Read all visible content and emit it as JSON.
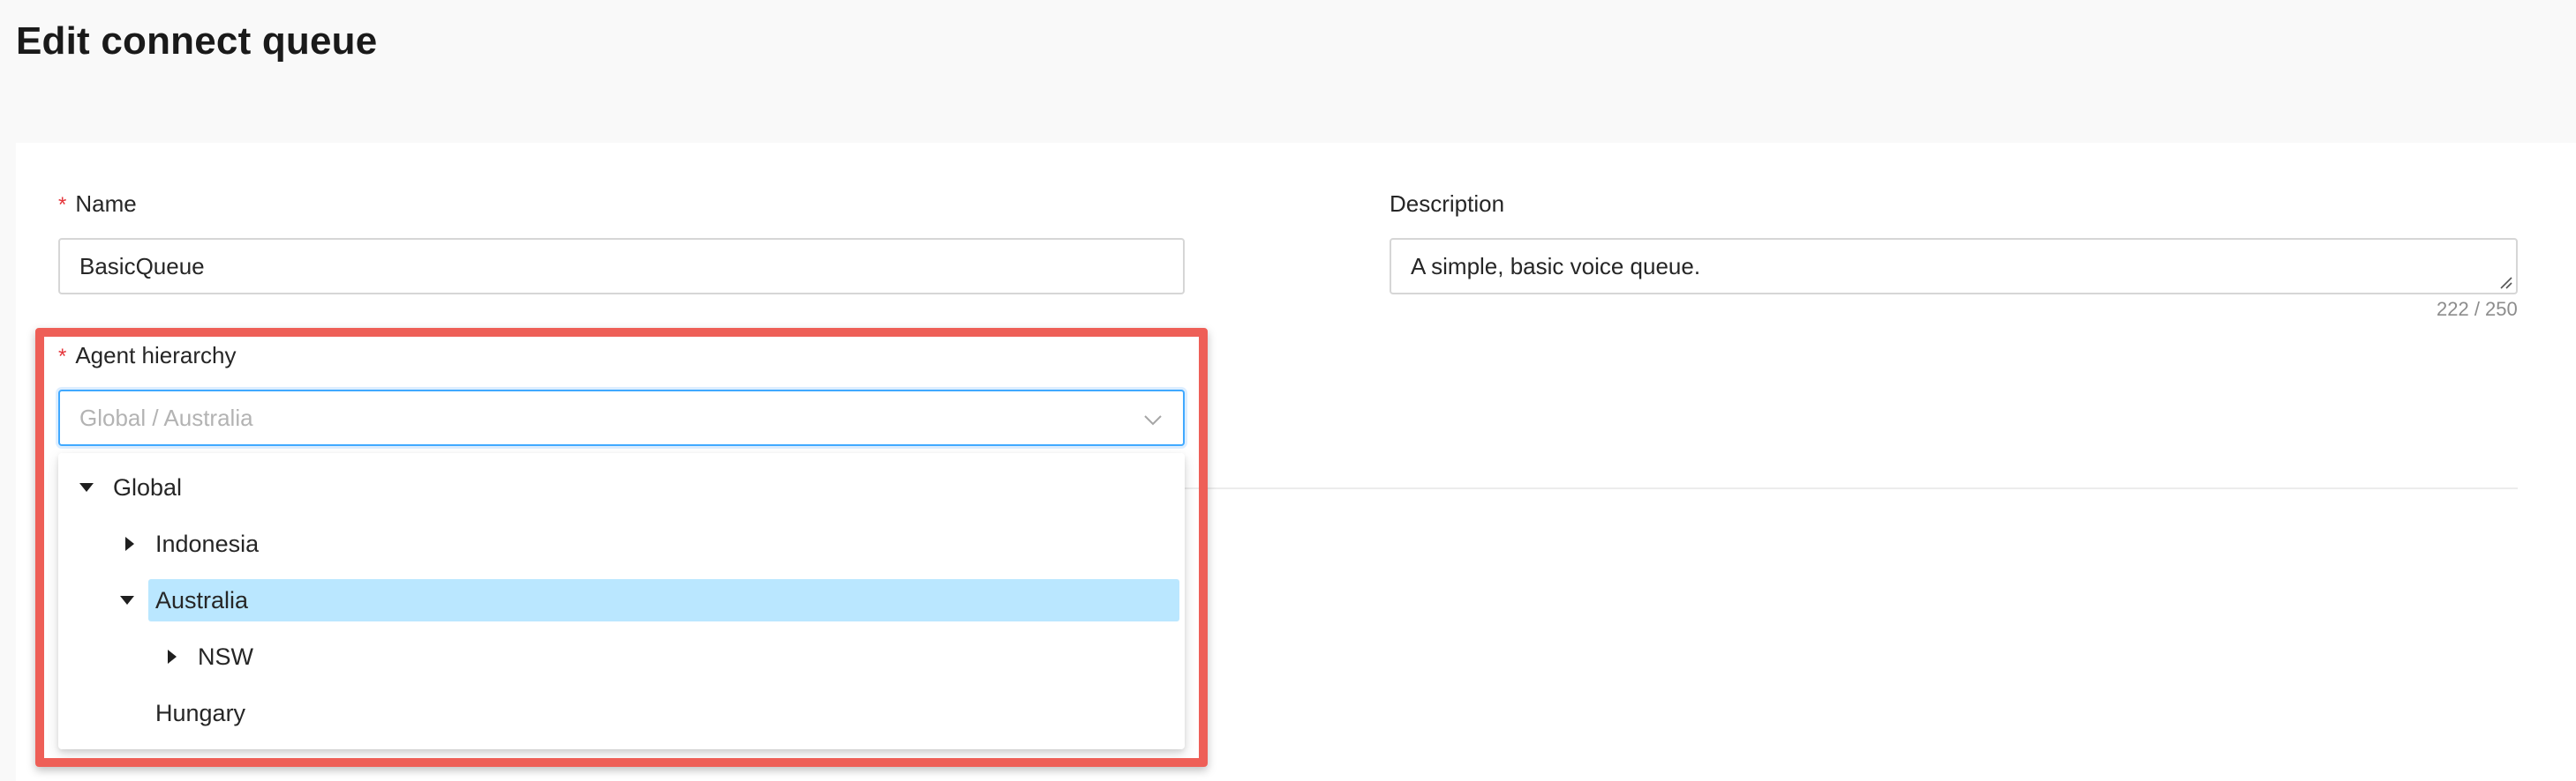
{
  "page": {
    "title": "Edit connect queue"
  },
  "form": {
    "name": {
      "label": "Name",
      "required_mark": "*",
      "value": "BasicQueue"
    },
    "description": {
      "label": "Description",
      "value": "A simple, basic voice queue.",
      "counter": "222 / 250"
    },
    "agent_hierarchy": {
      "label": "Agent hierarchy",
      "required_mark": "*",
      "placeholder": "Global / Australia",
      "tree": [
        {
          "label": "Global",
          "level": 0,
          "caret": "down",
          "selected": false
        },
        {
          "label": "Indonesia",
          "level": 1,
          "caret": "right",
          "selected": false
        },
        {
          "label": "Australia",
          "level": 1,
          "caret": "down",
          "selected": true
        },
        {
          "label": "NSW",
          "level": 2,
          "caret": "right",
          "selected": false
        },
        {
          "label": "Hungary",
          "level": 1,
          "caret": "none",
          "selected": false
        }
      ]
    }
  },
  "colors": {
    "required": "#e5343a",
    "focus_border": "#40a9ff",
    "selected_node": "#bae7ff",
    "highlight_box": "#ee5f57"
  },
  "icons": {
    "select_arrow": "chevron-down-icon",
    "expanded": "caret-down-icon",
    "collapsed": "caret-right-icon",
    "resize": "resize-grip-icon"
  }
}
